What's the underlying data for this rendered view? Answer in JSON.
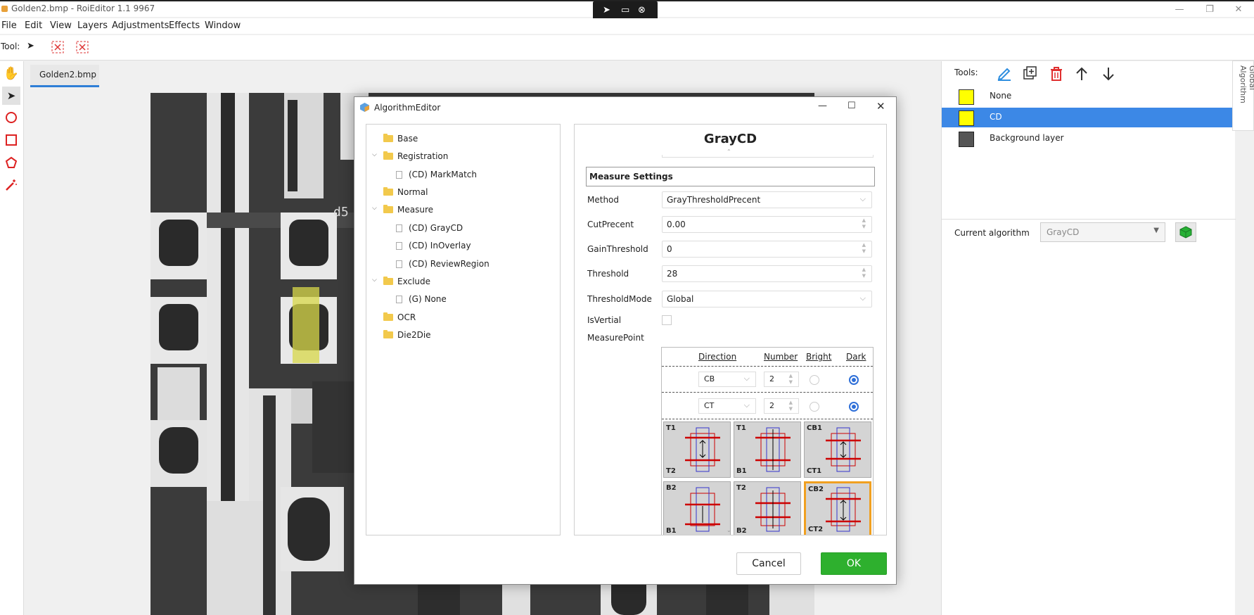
{
  "window": {
    "title": "Golden2.bmp - RoiEditor 1.1 9967",
    "controls": [
      "—",
      "❐",
      "✕"
    ]
  },
  "menu": [
    "File",
    "Edit",
    "View",
    "Layers",
    "Adjustments",
    "Effects",
    "Window"
  ],
  "toolbar": {
    "label": "Tool:"
  },
  "document": {
    "tab": "Golden2.bmp"
  },
  "right_panel": {
    "tools_label": "Tools:",
    "layers": [
      {
        "name": "None",
        "color": "#ffff00",
        "selected": false
      },
      {
        "name": "CD",
        "color": "#ffff00",
        "selected": true
      },
      {
        "name": "Background layer",
        "color": "#555555",
        "selected": false
      }
    ],
    "current_algorithm_label": "Current algorithm",
    "current_algorithm_value": "GrayCD",
    "side_tab": "Global Algorithm"
  },
  "dialog": {
    "title": "AlgorithmEditor",
    "tree": [
      {
        "label": "Base",
        "type": "folder",
        "level": 0
      },
      {
        "label": "Registration",
        "type": "folder",
        "level": 0,
        "expanded": true
      },
      {
        "label": "(CD) MarkMatch",
        "type": "file",
        "level": 1
      },
      {
        "label": "Normal",
        "type": "folder",
        "level": 0
      },
      {
        "label": "Measure",
        "type": "folder",
        "level": 0,
        "expanded": true
      },
      {
        "label": "(CD) GrayCD",
        "type": "file",
        "level": 1
      },
      {
        "label": "(CD) InOverlay",
        "type": "file",
        "level": 1
      },
      {
        "label": "(CD) ReviewRegion",
        "type": "file",
        "level": 1
      },
      {
        "label": "Exclude",
        "type": "folder",
        "level": 0,
        "expanded": true
      },
      {
        "label": "(G) None",
        "type": "file",
        "level": 1
      },
      {
        "label": "OCR",
        "type": "folder",
        "level": 0
      },
      {
        "label": "Die2Die",
        "type": "folder",
        "level": 0
      }
    ],
    "props": {
      "heading": "GrayCD",
      "section": "Measure Settings",
      "method_label": "Method",
      "method_value": "GrayThresholdPrecent",
      "cut_label": "CutPrecent",
      "cut_value": "0.00",
      "gain_label": "GainThreshold",
      "gain_value": "0",
      "threshold_label": "Threshold",
      "threshold_value": "28",
      "mode_label": "ThresholdMode",
      "mode_value": "Global",
      "vertial_label": "IsVertial",
      "mp_label": "MeasurePoint",
      "mp_headers": {
        "direction": "Direction",
        "number": "Number",
        "bright": "Bright",
        "dark": "Dark"
      },
      "mp_rows": [
        {
          "direction": "CB",
          "number": "2",
          "dark": true
        },
        {
          "direction": "CT",
          "number": "2",
          "dark": true
        }
      ],
      "thumbs": [
        {
          "top": "T1",
          "bottom": "T2"
        },
        {
          "top": "T1",
          "bottom": "B1"
        },
        {
          "top": "CB1",
          "bottom": "CT1"
        },
        {
          "top": "B2",
          "bottom": "B1"
        },
        {
          "top": "T2",
          "bottom": "B2"
        },
        {
          "top": "CB2",
          "bottom": "CT2"
        }
      ]
    },
    "cancel": "Cancel",
    "ok": "OK"
  }
}
